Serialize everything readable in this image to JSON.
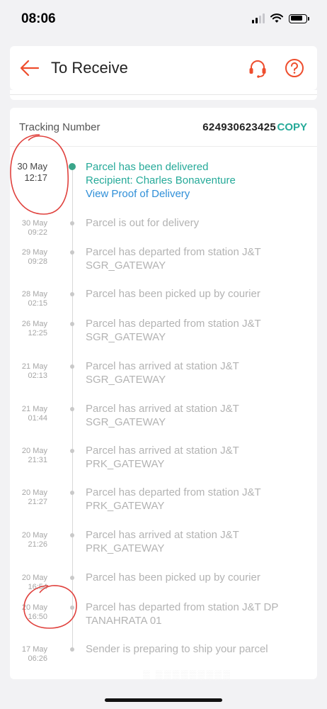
{
  "status_bar": {
    "time": "08:06"
  },
  "header": {
    "title": "To Receive"
  },
  "tracking": {
    "label": "Tracking Number",
    "number": "624930623425",
    "copy_label": "COPY"
  },
  "events": [
    {
      "date": "30 May",
      "time": "12:17",
      "lines": [
        "Parcel has been delivered",
        "Recipient: Charles Bonaventure"
      ],
      "link": "View Proof of Delivery",
      "active": true
    },
    {
      "date": "30 May",
      "time": "09:22",
      "lines": [
        "Parcel is out for delivery"
      ]
    },
    {
      "date": "29 May",
      "time": "09:28",
      "lines": [
        "Parcel has departed from station J&T",
        "SGR_GATEWAY"
      ]
    },
    {
      "date": "28 May",
      "time": "02:15",
      "lines": [
        "Parcel has been picked up by courier"
      ]
    },
    {
      "date": "26 May",
      "time": "12:25",
      "lines": [
        "Parcel has departed from station J&T",
        "SGR_GATEWAY"
      ]
    },
    {
      "date": "21 May",
      "time": "02:13",
      "lines": [
        "Parcel has arrived at station J&T",
        "SGR_GATEWAY"
      ]
    },
    {
      "date": "21 May",
      "time": "01:44",
      "lines": [
        "Parcel has arrived at station J&T",
        "SGR_GATEWAY"
      ]
    },
    {
      "date": "20 May",
      "time": "21:31",
      "lines": [
        "Parcel has arrived at station J&T",
        "PRK_GATEWAY"
      ]
    },
    {
      "date": "20 May",
      "time": "21:27",
      "lines": [
        "Parcel has departed from station J&T",
        "PRK_GATEWAY"
      ]
    },
    {
      "date": "20 May",
      "time": "21:26",
      "lines": [
        "Parcel has arrived at station J&T",
        "PRK_GATEWAY"
      ]
    },
    {
      "date": "20 May",
      "time": "16:54",
      "lines": [
        "Parcel has been picked up by courier"
      ]
    },
    {
      "date": "20 May",
      "time": "16:50",
      "lines": [
        "Parcel has departed from station J&T DP",
        "TANAHRATA 01"
      ]
    },
    {
      "date": "17 May",
      "time": "06:26",
      "lines": [
        "Sender is preparing to ship your parcel"
      ]
    }
  ],
  "colors": {
    "accent": "#ee4d2d",
    "teal": "#26aa99",
    "link": "#2f8fd8",
    "annotation": "#e0413d"
  }
}
